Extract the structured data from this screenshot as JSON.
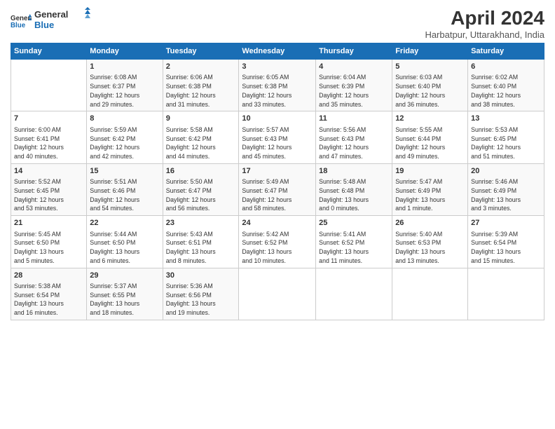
{
  "header": {
    "logo_line1": "General",
    "logo_line2": "Blue",
    "title": "April 2024",
    "location": "Harbatpur, Uttarakhand, India"
  },
  "columns": [
    "Sunday",
    "Monday",
    "Tuesday",
    "Wednesday",
    "Thursday",
    "Friday",
    "Saturday"
  ],
  "weeks": [
    [
      {
        "day": "",
        "info": ""
      },
      {
        "day": "1",
        "info": "Sunrise: 6:08 AM\nSunset: 6:37 PM\nDaylight: 12 hours\nand 29 minutes."
      },
      {
        "day": "2",
        "info": "Sunrise: 6:06 AM\nSunset: 6:38 PM\nDaylight: 12 hours\nand 31 minutes."
      },
      {
        "day": "3",
        "info": "Sunrise: 6:05 AM\nSunset: 6:38 PM\nDaylight: 12 hours\nand 33 minutes."
      },
      {
        "day": "4",
        "info": "Sunrise: 6:04 AM\nSunset: 6:39 PM\nDaylight: 12 hours\nand 35 minutes."
      },
      {
        "day": "5",
        "info": "Sunrise: 6:03 AM\nSunset: 6:40 PM\nDaylight: 12 hours\nand 36 minutes."
      },
      {
        "day": "6",
        "info": "Sunrise: 6:02 AM\nSunset: 6:40 PM\nDaylight: 12 hours\nand 38 minutes."
      }
    ],
    [
      {
        "day": "7",
        "info": "Sunrise: 6:00 AM\nSunset: 6:41 PM\nDaylight: 12 hours\nand 40 minutes."
      },
      {
        "day": "8",
        "info": "Sunrise: 5:59 AM\nSunset: 6:42 PM\nDaylight: 12 hours\nand 42 minutes."
      },
      {
        "day": "9",
        "info": "Sunrise: 5:58 AM\nSunset: 6:42 PM\nDaylight: 12 hours\nand 44 minutes."
      },
      {
        "day": "10",
        "info": "Sunrise: 5:57 AM\nSunset: 6:43 PM\nDaylight: 12 hours\nand 45 minutes."
      },
      {
        "day": "11",
        "info": "Sunrise: 5:56 AM\nSunset: 6:43 PM\nDaylight: 12 hours\nand 47 minutes."
      },
      {
        "day": "12",
        "info": "Sunrise: 5:55 AM\nSunset: 6:44 PM\nDaylight: 12 hours\nand 49 minutes."
      },
      {
        "day": "13",
        "info": "Sunrise: 5:53 AM\nSunset: 6:45 PM\nDaylight: 12 hours\nand 51 minutes."
      }
    ],
    [
      {
        "day": "14",
        "info": "Sunrise: 5:52 AM\nSunset: 6:45 PM\nDaylight: 12 hours\nand 53 minutes."
      },
      {
        "day": "15",
        "info": "Sunrise: 5:51 AM\nSunset: 6:46 PM\nDaylight: 12 hours\nand 54 minutes."
      },
      {
        "day": "16",
        "info": "Sunrise: 5:50 AM\nSunset: 6:47 PM\nDaylight: 12 hours\nand 56 minutes."
      },
      {
        "day": "17",
        "info": "Sunrise: 5:49 AM\nSunset: 6:47 PM\nDaylight: 12 hours\nand 58 minutes."
      },
      {
        "day": "18",
        "info": "Sunrise: 5:48 AM\nSunset: 6:48 PM\nDaylight: 13 hours\nand 0 minutes."
      },
      {
        "day": "19",
        "info": "Sunrise: 5:47 AM\nSunset: 6:49 PM\nDaylight: 13 hours\nand 1 minute."
      },
      {
        "day": "20",
        "info": "Sunrise: 5:46 AM\nSunset: 6:49 PM\nDaylight: 13 hours\nand 3 minutes."
      }
    ],
    [
      {
        "day": "21",
        "info": "Sunrise: 5:45 AM\nSunset: 6:50 PM\nDaylight: 13 hours\nand 5 minutes."
      },
      {
        "day": "22",
        "info": "Sunrise: 5:44 AM\nSunset: 6:50 PM\nDaylight: 13 hours\nand 6 minutes."
      },
      {
        "day": "23",
        "info": "Sunrise: 5:43 AM\nSunset: 6:51 PM\nDaylight: 13 hours\nand 8 minutes."
      },
      {
        "day": "24",
        "info": "Sunrise: 5:42 AM\nSunset: 6:52 PM\nDaylight: 13 hours\nand 10 minutes."
      },
      {
        "day": "25",
        "info": "Sunrise: 5:41 AM\nSunset: 6:52 PM\nDaylight: 13 hours\nand 11 minutes."
      },
      {
        "day": "26",
        "info": "Sunrise: 5:40 AM\nSunset: 6:53 PM\nDaylight: 13 hours\nand 13 minutes."
      },
      {
        "day": "27",
        "info": "Sunrise: 5:39 AM\nSunset: 6:54 PM\nDaylight: 13 hours\nand 15 minutes."
      }
    ],
    [
      {
        "day": "28",
        "info": "Sunrise: 5:38 AM\nSunset: 6:54 PM\nDaylight: 13 hours\nand 16 minutes."
      },
      {
        "day": "29",
        "info": "Sunrise: 5:37 AM\nSunset: 6:55 PM\nDaylight: 13 hours\nand 18 minutes."
      },
      {
        "day": "30",
        "info": "Sunrise: 5:36 AM\nSunset: 6:56 PM\nDaylight: 13 hours\nand 19 minutes."
      },
      {
        "day": "",
        "info": ""
      },
      {
        "day": "",
        "info": ""
      },
      {
        "day": "",
        "info": ""
      },
      {
        "day": "",
        "info": ""
      }
    ]
  ]
}
